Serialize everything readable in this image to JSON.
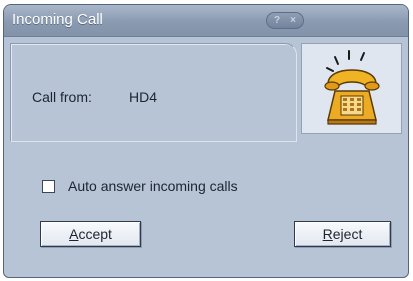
{
  "window": {
    "title": "Incoming Call",
    "help_button": "?",
    "close_button": "×"
  },
  "call": {
    "from_label": "Call from:",
    "from_value": "HD4"
  },
  "icon": "telephone-icon",
  "options": {
    "auto_answer_label": "Auto answer incoming calls",
    "auto_answer_checked": false
  },
  "buttons": {
    "accept_mnemonic": "A",
    "accept_rest": "ccept",
    "reject_mnemonic": "R",
    "reject_rest": "eject"
  },
  "colors": {
    "window_bg": "#b6c4d6",
    "titlebar": "#8a9ab1",
    "phone_body": "#e8a820"
  }
}
